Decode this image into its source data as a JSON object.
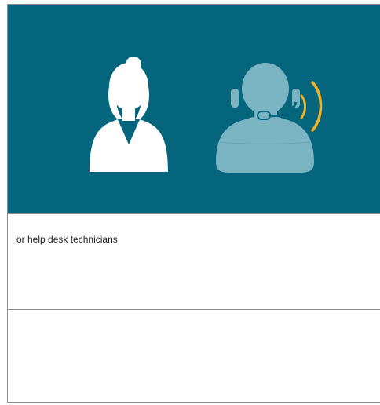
{
  "caption": {
    "text": "or help desk technicians"
  },
  "icons": {
    "person": "woman-user-icon",
    "support": "headset-support-agent-icon",
    "signal": "sound-waves-icon"
  },
  "colors": {
    "hero_background": "#04657c",
    "person": "#ffffff",
    "support_agent": "#7ab3c2",
    "sound_waves": "#f5b021",
    "border": "#8c8c8c"
  }
}
